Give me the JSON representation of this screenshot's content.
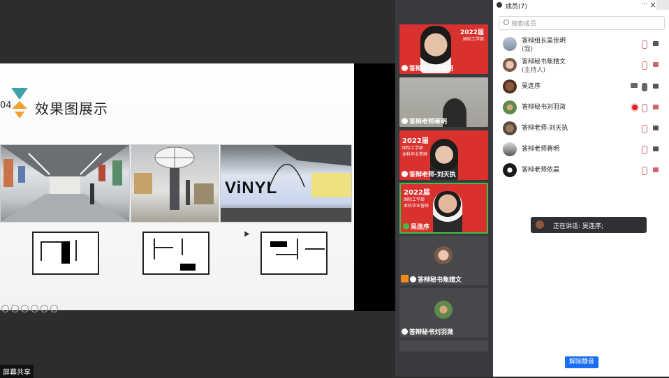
{
  "slide": {
    "num": "04",
    "title": "效果图展示",
    "photo3_text": "ViNYL"
  },
  "share_label": "屏幕共享",
  "participants": [
    {
      "label": "答辩组长吴佳玥",
      "bg": "red"
    },
    {
      "label": "答辩老师蒋明",
      "bg": "gray"
    },
    {
      "label": "答辩老师-刘天执",
      "bg": "red"
    },
    {
      "label": "吴连序",
      "bg": "red",
      "speaking": true
    },
    {
      "label": "答辩秘书焦婧文",
      "bg": "gray"
    },
    {
      "label": "答辩秘书刘羽溦",
      "bg": "gray"
    }
  ],
  "banner": {
    "year": "2022届",
    "dept": "国际工学部",
    "sub": "本科毕业答辩"
  },
  "panel": {
    "title": "成员(7)",
    "more": "···",
    "close": "×",
    "search_placeholder": "搜索成员",
    "members": [
      {
        "name": "答辩组长吴佳玥",
        "sub": "(我)"
      },
      {
        "name": "答辩秘书焦婧文",
        "sub": "(主持人)"
      },
      {
        "name": "吴连序",
        "sub": ""
      },
      {
        "name": "答辩秘书刘羽溦",
        "sub": ""
      },
      {
        "name": "答辩老师-刘天执",
        "sub": ""
      },
      {
        "name": "答辩老师蒋明",
        "sub": ""
      },
      {
        "name": "答辩老师依晨",
        "sub": ""
      }
    ],
    "speaking": "正在讲话: 吴连序;",
    "unmute": "解除静音"
  },
  "colors": {
    "accent": "#1a6ff0",
    "banner_red": "#d9312d",
    "speaking_green": "#3fbf4a",
    "muted_red": "#c86a6a"
  }
}
